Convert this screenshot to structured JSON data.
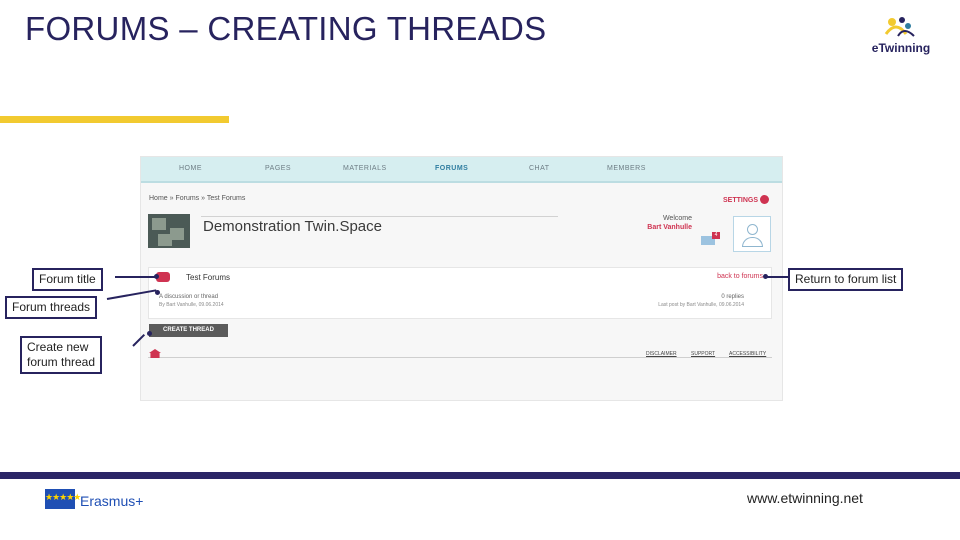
{
  "slide": {
    "title": "FORUMS – CREATING THREADS",
    "logo_text": "eTwinning",
    "website": "www.etwinning.net",
    "erasmus_label": "Erasmus+",
    "eu_stars": "★★★★★"
  },
  "colors": {
    "title": "#27235e",
    "accent": "#f2ca30",
    "brand_red": "#cf3351",
    "nav_bg": "#d6eef0"
  },
  "screenshot": {
    "nav_items": [
      "HOME",
      "PAGES",
      "MATERIALS",
      "FORUMS",
      "CHAT",
      "MEMBERS"
    ],
    "active_nav": "FORUMS",
    "breadcrumb": "Home  »  Forums  »  Test Forums",
    "settings_label": "SETTINGS",
    "space_title": "Demonstration Twin.Space",
    "welcome_label": "Welcome",
    "user_name": "Bart Vanhulle",
    "mail_count": "4",
    "forum_title": "Test Forums",
    "back_link": "back to forums",
    "thread_name": "A discussion or thread",
    "thread_author": "By Bart Vanhulle, 09.06.2014",
    "thread_replies": "0 replies",
    "thread_last_post": "Last post by Bart Vanhulle, 09.06.2014",
    "create_thread_label": "CREATE THREAD",
    "footer_links": [
      "DISCLAIMER",
      "SUPPORT",
      "ACCESSIBILITY"
    ]
  },
  "callouts": {
    "forum_title": "Forum title",
    "forum_threads": "Forum threads",
    "create_new_line1": "Create new",
    "create_new_line2": "forum thread",
    "return_to_list": "Return to forum list"
  }
}
